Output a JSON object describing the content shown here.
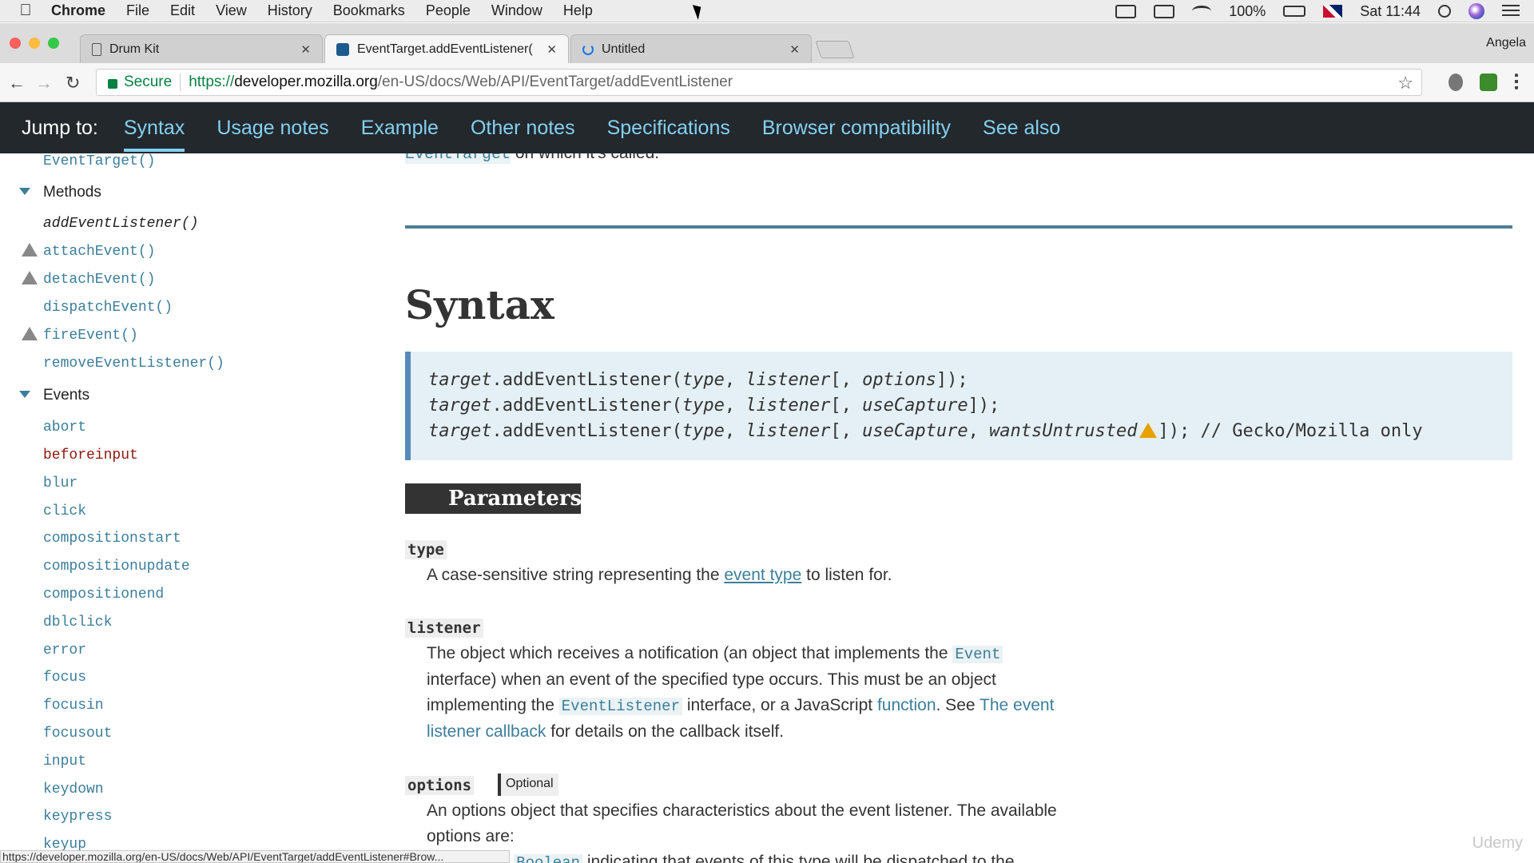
{
  "menubar": {
    "app": "Chrome",
    "items": [
      "File",
      "Edit",
      "View",
      "History",
      "Bookmarks",
      "People",
      "Window",
      "Help"
    ],
    "battery": "100%",
    "clock": "Sat 11:44"
  },
  "tabs": [
    {
      "title": "Drum Kit",
      "icon": "document-icon"
    },
    {
      "title": "EventTarget.addEventListener(",
      "icon": "mdn-icon"
    },
    {
      "title": "Untitled",
      "icon": "loading-icon"
    }
  ],
  "profile": "Angela",
  "omnibox": {
    "secure_label": "Secure",
    "url_scheme": "https://",
    "url_host": "developer.mozilla.org",
    "url_path": "/en-US/docs/Web/API/EventTarget/addEventListener"
  },
  "jumpbar": {
    "label": "Jump to:",
    "links": [
      "Syntax",
      "Usage notes",
      "Example",
      "Other notes",
      "Specifications",
      "Browser compatibility",
      "See also"
    ]
  },
  "sidebar": {
    "top_item": "EventTarget()",
    "methods_heading": "Methods",
    "methods": [
      "addEventListener()",
      "attachEvent()",
      "detachEvent()",
      "dispatchEvent()",
      "fireEvent()",
      "removeEventListener()"
    ],
    "events_heading": "Events",
    "events": [
      "abort",
      "beforeinput",
      "blur",
      "click",
      "compositionstart",
      "compositionupdate",
      "compositionend",
      "dblclick",
      "error",
      "focus",
      "focusin",
      "focusout",
      "input",
      "keydown",
      "keypress",
      "keyup"
    ]
  },
  "main": {
    "top_fragment_code": "EventTarget",
    "top_fragment_text": " on which it's called.",
    "syntax_heading": "Syntax",
    "code_lines": [
      {
        "obj": "target",
        "method": ".addEventListener(",
        "a1": "type",
        "sep1": ", ",
        "a2": "listener",
        "open": "[, ",
        "a3": "options",
        "close": "]);",
        "a4": "",
        "tail": ""
      },
      {
        "obj": "target",
        "method": ".addEventListener(",
        "a1": "type",
        "sep1": ", ",
        "a2": "listener",
        "open": "[, ",
        "a3": "useCapture",
        "close": "]);",
        "a4": "",
        "tail": ""
      },
      {
        "obj": "target",
        "method": ".addEventListener(",
        "a1": "type",
        "sep1": ", ",
        "a2": "listener",
        "open": "[, ",
        "a3": "useCapture",
        "close": ", ",
        "a4": "wantsUntrusted",
        "tail": "]); // Gecko/Mozilla only"
      }
    ],
    "parameters_heading": "Parameters",
    "params": {
      "type": {
        "term": "type",
        "desc_1": "A case-sensitive string representing the ",
        "link": "event type",
        "desc_2": " to listen for."
      },
      "listener": {
        "term": "listener",
        "t1": "The object which receives a notification (an object that implements the ",
        "code1": "Event",
        "t2": "interface) when an event of the specified type occurs. This must be an object",
        "t3": "implementing the ",
        "code2": "EventListener",
        "t4": " interface, or a JavaScript ",
        "link1": "function",
        "t5": ". See ",
        "link2a": "The event",
        "link2b": "listener callback",
        "t6": " for details on the callback itself."
      },
      "options": {
        "term": "options",
        "badge": "Optional",
        "t1": "An options object that specifies characteristics about the event listener. The available",
        "t2": "options are:",
        "t3_code": "Boolean",
        "t3_pre": ": A ",
        "t3_post": " indicating that events of this type will be dispatched to the"
      }
    }
  },
  "statusbar": "https://developer.mozilla.org/en-US/docs/Web/API/EventTarget/addEventListener#Brow...",
  "watermark": "Udemy"
}
